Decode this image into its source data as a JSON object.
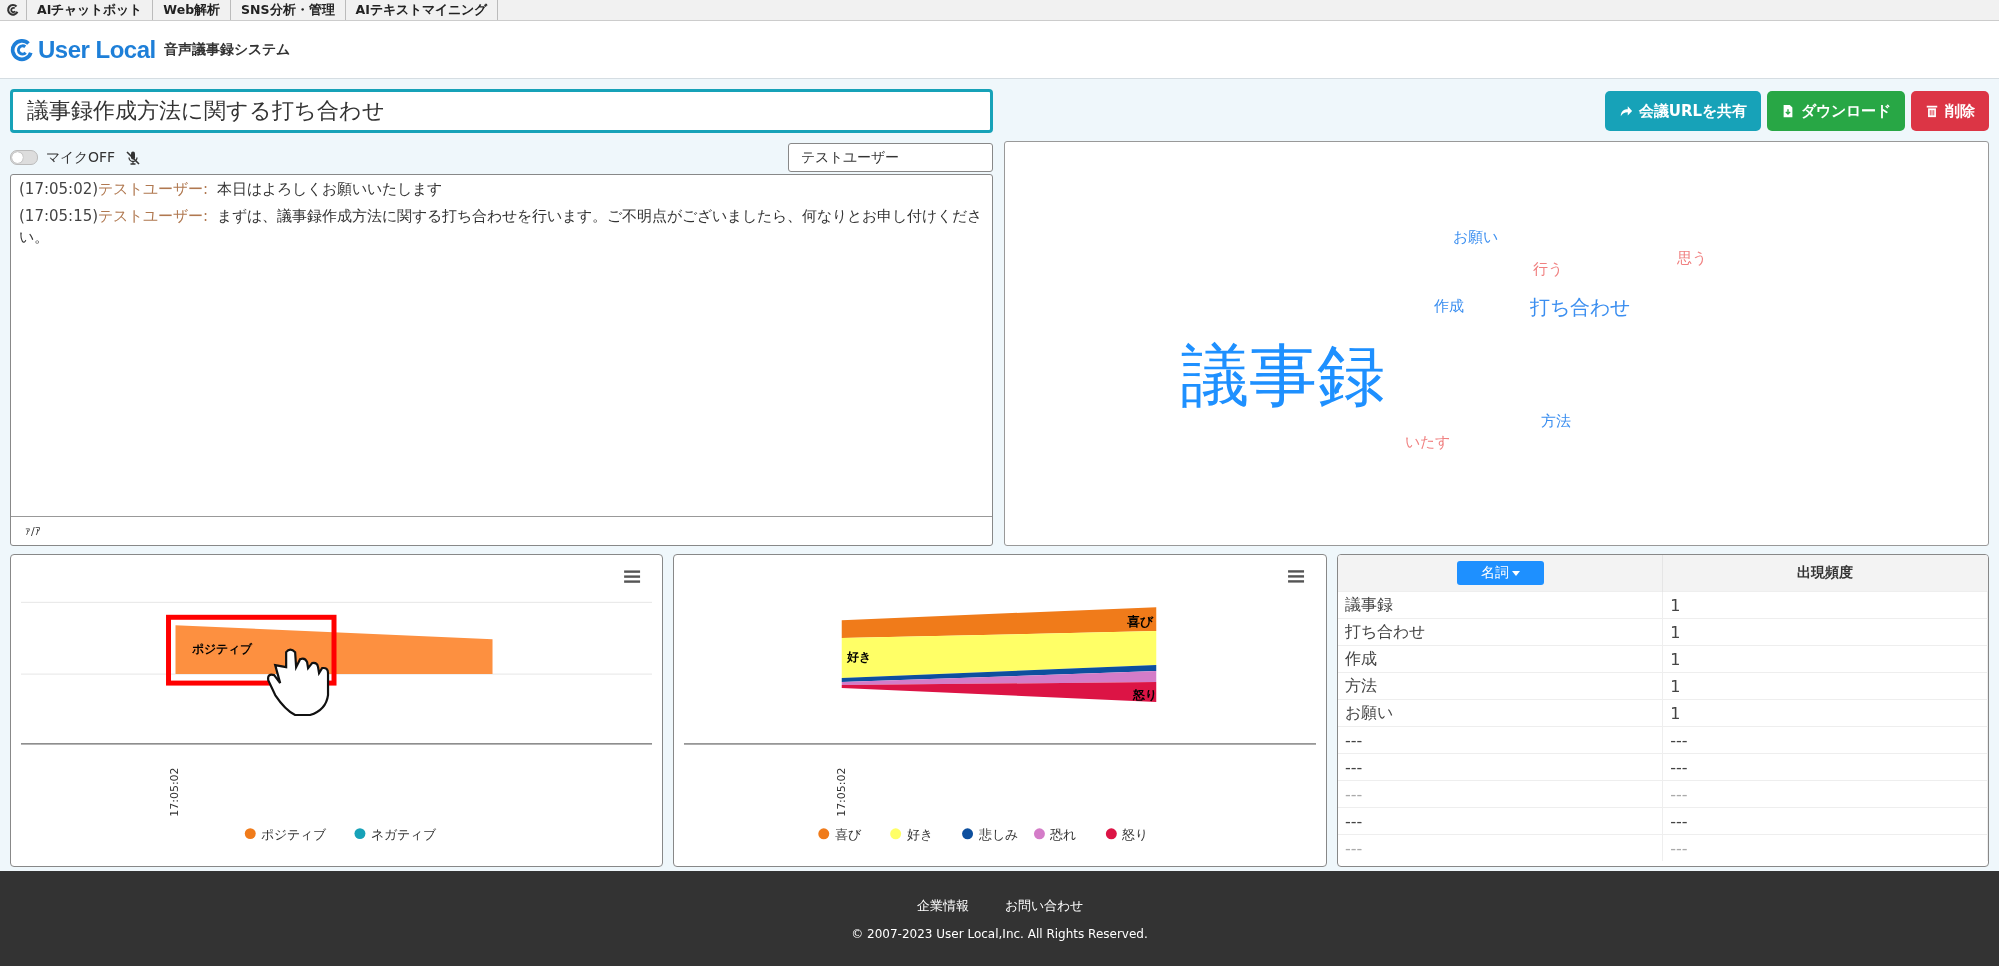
{
  "top_nav": {
    "items": [
      "AIチャットボット",
      "Web解析",
      "SNS分析・管理",
      "AIテキストマイニング"
    ]
  },
  "header": {
    "logo": "User Local",
    "product": "音声議事録システム"
  },
  "meeting_title": {
    "value": "議事録作成方法に関する打ち合わせ"
  },
  "actions": [
    {
      "label": "会議URLを共有",
      "kind": "share"
    },
    {
      "label": "ダウンロード",
      "kind": "download"
    },
    {
      "label": "削除",
      "kind": "delete"
    }
  ],
  "mic": {
    "label": "マイクOFF",
    "on": false
  },
  "speaker_select": {
    "value": "テストユーザー"
  },
  "transcript": {
    "entries": [
      {
        "time": "(17:05:02)",
        "speaker": "テストユーザー:",
        "text": "本日はよろしくお願いいたします"
      },
      {
        "time": "(17:05:15)",
        "speaker": "テストユーザー:",
        "text": "まずは、議事録作成方法に関する打ち合わせを行います。ご不明点がございましたら、何なりとお申し付けください。"
      }
    ],
    "footer": "ｧ/ｱ"
  },
  "word_cloud": [
    {
      "text": "お願い",
      "color": "#3a8ef0",
      "kind": "small"
    },
    {
      "text": "行う",
      "color": "#f08080",
      "kind": "small"
    },
    {
      "text": "思う",
      "color": "#f08080",
      "kind": "small"
    },
    {
      "text": "作成",
      "color": "#3a8ef0",
      "kind": "small"
    },
    {
      "text": "打ち合わせ",
      "color": "#3a8ef0",
      "kind": "medium"
    },
    {
      "text": "議事録",
      "color": "#1e90ff",
      "kind": "large"
    },
    {
      "text": "方法",
      "color": "#3a8ef0",
      "kind": "small"
    },
    {
      "text": "いたす",
      "color": "#f08080",
      "kind": "small"
    }
  ],
  "sentiment_chart": {
    "x_label": "17:05:02",
    "area_label": "ポジティブ",
    "legend": [
      {
        "label": "ポジティブ",
        "color": "#f07b1a"
      },
      {
        "label": "ネガティブ",
        "color": "#17a2b8"
      }
    ]
  },
  "emotion_chart": {
    "x_label": "17:05:02",
    "area_labels": [
      "喜び",
      "好き",
      "怒り"
    ],
    "legend": [
      {
        "label": "喜び",
        "color": "#f07b1a"
      },
      {
        "label": "好き",
        "color": "#ffff66"
      },
      {
        "label": "悲しみ",
        "color": "#0d4f9e"
      },
      {
        "label": "恐れ",
        "color": "#d47cc8"
      },
      {
        "label": "怒り",
        "color": "#dc1445"
      }
    ]
  },
  "word_table": {
    "columns": [
      "名詞",
      "出現頻度"
    ],
    "rows": [
      {
        "cells": [
          "議事録",
          "1"
        ],
        "faded": false
      },
      {
        "cells": [
          "打ち合わせ",
          "1"
        ],
        "faded": false
      },
      {
        "cells": [
          "作成",
          "1"
        ],
        "faded": false
      },
      {
        "cells": [
          "方法",
          "1"
        ],
        "faded": false
      },
      {
        "cells": [
          "お願い",
          "1"
        ],
        "faded": false
      },
      {
        "cells": [
          "---",
          "---"
        ],
        "faded": false
      },
      {
        "cells": [
          "---",
          "---"
        ],
        "faded": false
      },
      {
        "cells": [
          "---",
          "---"
        ],
        "faded": true
      },
      {
        "cells": [
          "---",
          "---"
        ],
        "faded": false
      },
      {
        "cells": [
          "---",
          "---"
        ],
        "faded": true
      }
    ]
  },
  "footer": {
    "links": [
      "企業情報",
      "お問い合わせ"
    ],
    "copyright": "© 2007-2023 User Local,Inc. All Rights Reserved."
  }
}
